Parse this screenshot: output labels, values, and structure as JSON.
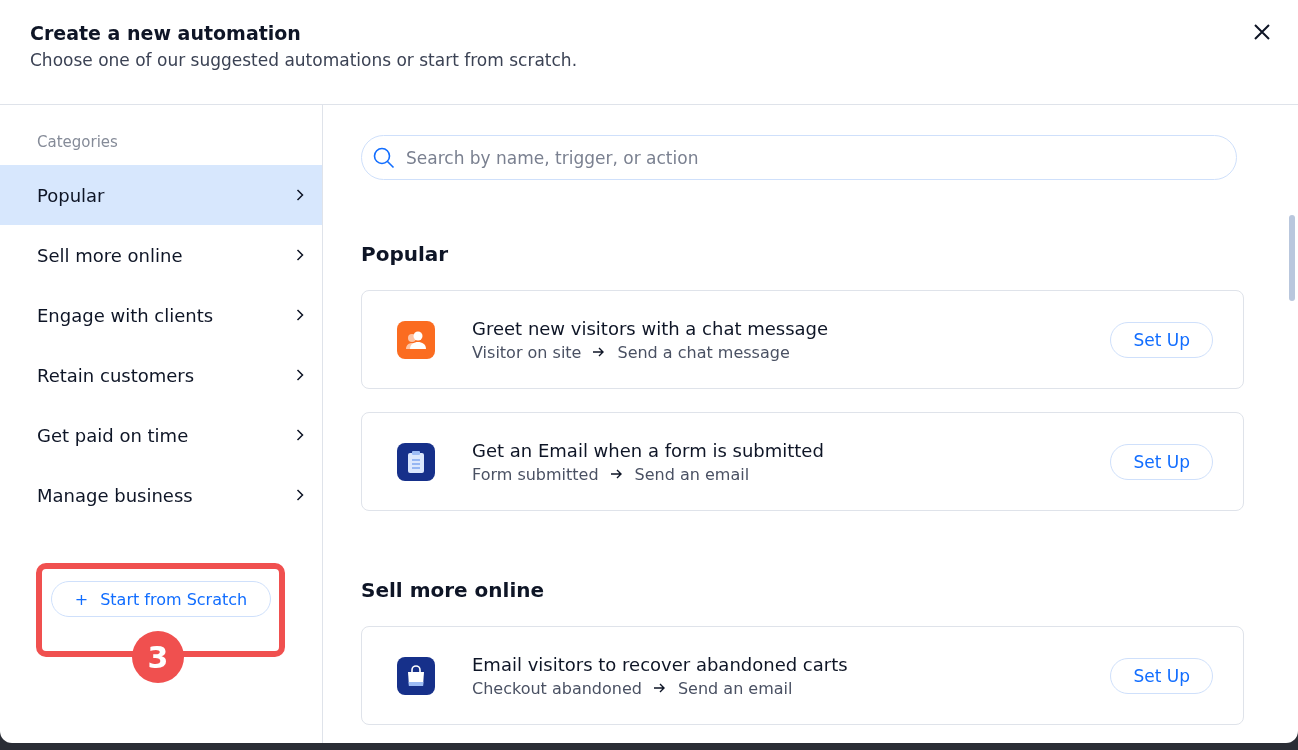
{
  "dialog": {
    "title": "Create a new automation",
    "subtitle": "Choose one of our suggested automations or start from scratch."
  },
  "sidebar": {
    "heading": "Categories",
    "items": [
      {
        "label": "Popular",
        "selected": true
      },
      {
        "label": "Sell more online",
        "selected": false
      },
      {
        "label": "Engage with clients",
        "selected": false
      },
      {
        "label": "Retain customers",
        "selected": false
      },
      {
        "label": "Get paid on time",
        "selected": false
      },
      {
        "label": "Manage business",
        "selected": false
      }
    ],
    "start_button": {
      "icon": "+",
      "label": "Start from Scratch"
    },
    "annotation": {
      "label": "3"
    }
  },
  "search": {
    "placeholder": "Search by name, trigger, or action"
  },
  "sections": [
    {
      "title": "Popular",
      "cards": [
        {
          "kind": "chat",
          "color": "#fb6c20",
          "title": "Greet new visitors with a chat message",
          "trigger": "Visitor on site",
          "action": "Send a chat message",
          "button": "Set Up"
        },
        {
          "kind": "form",
          "color": "#16308a",
          "title": "Get an Email when a form is submitted",
          "trigger": "Form submitted",
          "action": "Send an email",
          "button": "Set Up"
        }
      ]
    },
    {
      "title": "Sell more online",
      "cards": [
        {
          "kind": "cart",
          "color": "#16308a",
          "title": "Email visitors to recover abandoned carts",
          "trigger": "Checkout abandoned",
          "action": "Send an email",
          "button": "Set Up"
        }
      ]
    }
  ]
}
